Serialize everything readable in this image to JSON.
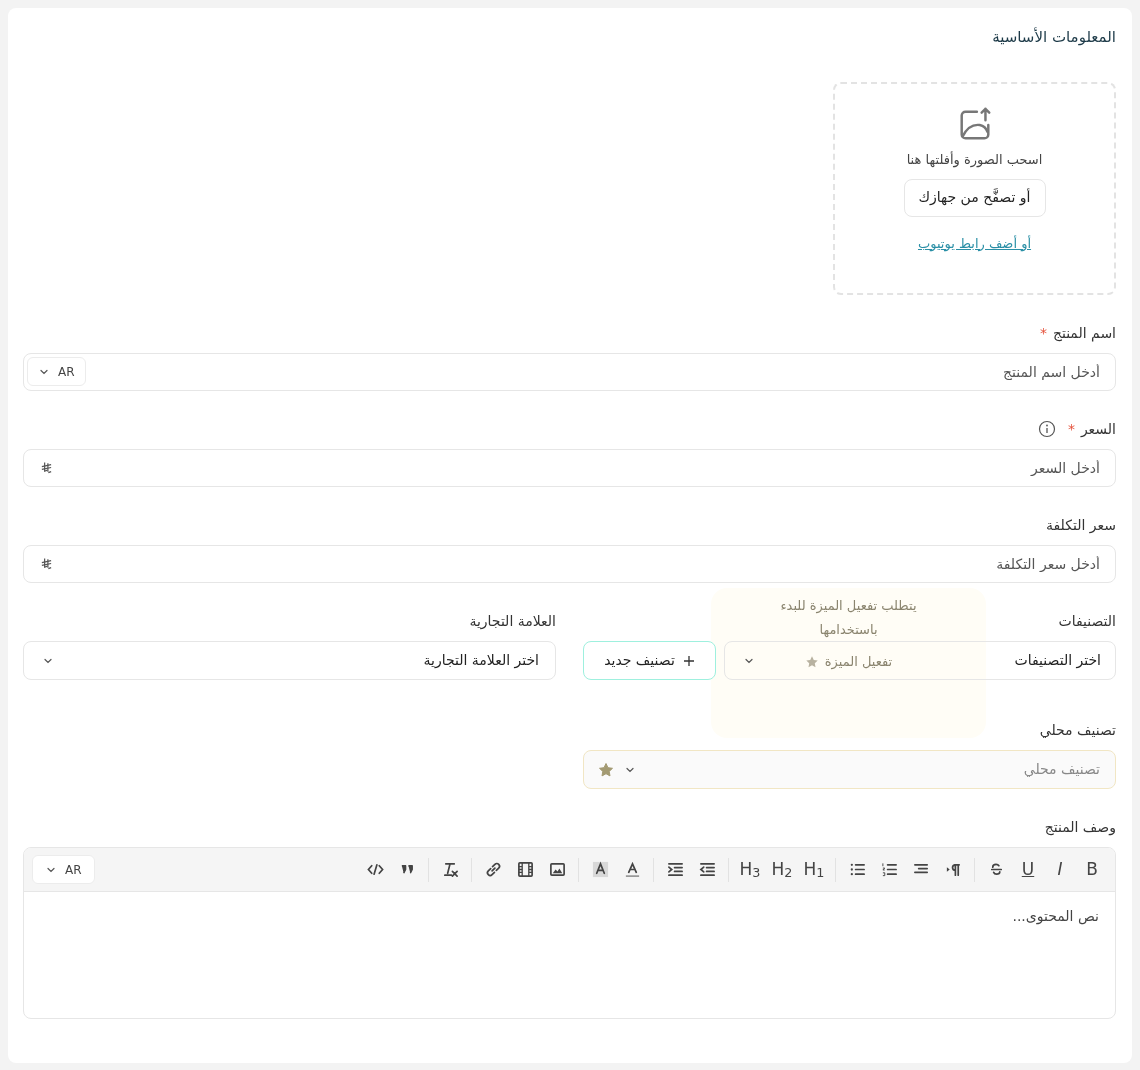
{
  "section_title": "المعلومات الأساسية",
  "upload": {
    "hint": "اسحب الصورة وأفلتها هنا",
    "browse_button": "أو تصفَّح من جهازك",
    "youtube_link": "أو أضف رابط يوتيوب"
  },
  "product_name": {
    "label": "اسم المنتج",
    "required_mark": "*",
    "placeholder": "أدخل اسم المنتج",
    "language": "AR"
  },
  "price": {
    "label": "السعر",
    "required_mark": "*",
    "info": true,
    "placeholder": "أدخل السعر"
  },
  "cost_price": {
    "label": "سعر التكلفة",
    "placeholder": "أدخل سعر التكلفة"
  },
  "categories": {
    "label": "التصنيفات",
    "placeholder": "اختر التصنيفات",
    "new_button": "تصنيف جديد"
  },
  "brand": {
    "label": "العلامة التجارية",
    "placeholder": "اختر العلامة التجارية"
  },
  "feature_popup": {
    "message": "يتطلب تفعيل الميزة للبدء باستخدامها",
    "button": "تفعيل الميزة"
  },
  "local_category": {
    "label": "تصنيف محلي",
    "placeholder": "تصنيف محلي",
    "disabled": true
  },
  "description": {
    "label": "وصف المنتج",
    "language": "AR",
    "placeholder": "نص المحتوى...",
    "toolbar": [
      [
        {
          "kind": "text",
          "label": "B"
        },
        {
          "kind": "text",
          "label": "I"
        },
        {
          "kind": "text",
          "label": "U"
        },
        {
          "kind": "icon"
        }
      ],
      [
        {
          "kind": "icon"
        },
        {
          "kind": "icon"
        },
        {
          "kind": "icon"
        },
        {
          "kind": "icon"
        }
      ],
      [
        {
          "kind": "text",
          "label": "H$_{1}$"
        },
        {
          "kind": "text",
          "label": "H$_{2}$"
        },
        {
          "kind": "text",
          "label": "H$_{3}$"
        }
      ],
      [
        {
          "kind": "icon"
        },
        {
          "kind": "icon"
        }
      ],
      [
        {
          "kind": "icon"
        },
        {
          "kind": "icon"
        }
      ],
      [
        {
          "kind": "icon"
        },
        {
          "kind": "icon"
        },
        {
          "kind": "icon"
        }
      ],
      [
        {
          "kind": "icon"
        }
      ],
      [
        {
          "kind": "icon"
        },
        {
          "kind": "icon"
        }
      ]
    ]
  }
}
